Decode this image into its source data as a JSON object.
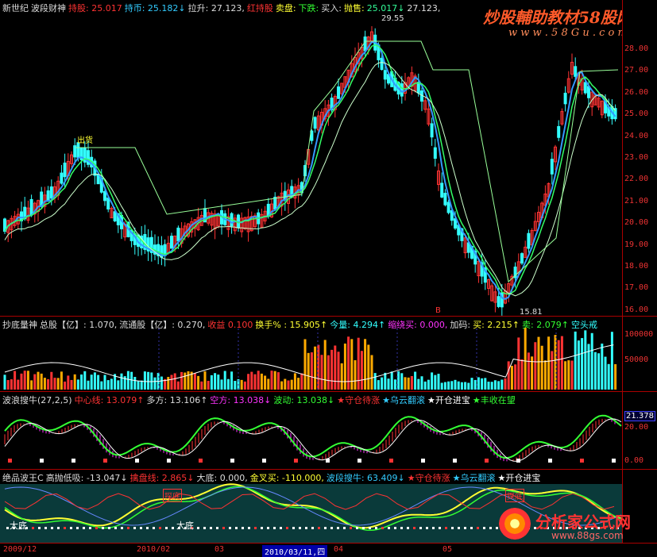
{
  "main_header": [
    {
      "text": "新世纪",
      "color": "#dddddd"
    },
    {
      "text": "波段财神",
      "color": "#dddddd"
    },
    {
      "text": "持股: 25.017",
      "color": "#ff3333"
    },
    {
      "text": "持币: 25.182↓",
      "color": "#33ccff"
    },
    {
      "text": "拉升: 27.123,",
      "color": "#dddddd"
    },
    {
      "text": "红持股",
      "color": "#ff3333"
    },
    {
      "text": "卖盘:",
      "color": "#ffff33"
    },
    {
      "text": "下跌:",
      "color": "#33ff33"
    },
    {
      "text": "买入:",
      "color": "#dddddd"
    },
    {
      "text": "抛售:",
      "color": "#ffff33"
    },
    {
      "text": "25.017↓",
      "color": "#33ff99"
    },
    {
      "text": "27.123,",
      "color": "#dddddd"
    }
  ],
  "watermark_top": {
    "text": "炒股輔助教材58股网",
    "sub": "w w w . 5 8 G u . c o m"
  },
  "watermark_bottom": {
    "text": "分析家公式网",
    "sub": "www.88gs.com"
  },
  "price_axis": [
    "28.00",
    "27.00",
    "26.00",
    "25.00",
    "24.00",
    "23.00",
    "22.00",
    "21.00",
    "20.00",
    "19.00",
    "18.00",
    "17.00",
    "16.00"
  ],
  "price_labels": {
    "high": "29.55",
    "low": "15.81",
    "sell_tag": "出货",
    "buy_tag": "B"
  },
  "vol_header": [
    {
      "text": "抄底量神",
      "color": "#dddddd"
    },
    {
      "text": "总股【亿】: 1.070,",
      "color": "#dddddd"
    },
    {
      "text": "流通股【亿】: 0.270,",
      "color": "#dddddd"
    },
    {
      "text": "收益 0.100",
      "color": "#ff3333"
    },
    {
      "text": "换手% : 15.905↑",
      "color": "#ffff33"
    },
    {
      "text": "今量: 4.294↑",
      "color": "#33ffff"
    },
    {
      "text": "缩绕买: 0.000,",
      "color": "#ff33ff"
    },
    {
      "text": "加码:",
      "color": "#dddddd"
    },
    {
      "text": "买: 2.215↑",
      "color": "#ffff33"
    },
    {
      "text": "卖: 2.079↑",
      "color": "#33ff33"
    },
    {
      "text": "空头戒",
      "color": "#33ffff"
    }
  ],
  "vol_axis": [
    "100000",
    "50000"
  ],
  "osc1_header": [
    {
      "text": "波浪搜牛(27,2,5)",
      "color": "#dddddd"
    },
    {
      "text": "中心线: 13.079↑",
      "color": "#ff3333"
    },
    {
      "text": "多方: 13.106↑",
      "color": "#dddddd"
    },
    {
      "text": "空方: 13.038↓",
      "color": "#ff33ff"
    },
    {
      "text": "波动: 13.038↓",
      "color": "#33ff33"
    },
    {
      "text": "★守仓待涨",
      "color": "#ff3333"
    },
    {
      "text": "★乌云翻滚",
      "color": "#33ccff"
    },
    {
      "text": "★开仓进宝",
      "color": "#ffffff"
    },
    {
      "text": "★丰收在望",
      "color": "#33ff33"
    }
  ],
  "osc1_axis": {
    "current": "21.378",
    "ticks": [
      "20.00",
      "0.00"
    ]
  },
  "osc2_header": [
    {
      "text": "绝品波王C",
      "color": "#dddddd"
    },
    {
      "text": "高抛低吸: -13.047↓",
      "color": "#dddddd"
    },
    {
      "text": "擒盘线: 2.865↓",
      "color": "#ff3333"
    },
    {
      "text": "大底: 0.000,",
      "color": "#dddddd"
    },
    {
      "text": "金叉买: -110.000,",
      "color": "#ffff33"
    },
    {
      "text": "波段搜牛: 63.409↓",
      "color": "#33ccff"
    },
    {
      "text": "★守仓待涨",
      "color": "#ff3333"
    },
    {
      "text": "★乌云翻滚",
      "color": "#33ccff"
    },
    {
      "text": "★开仓进宝",
      "color": "#ffffff"
    }
  ],
  "osc2_labels": {
    "bottom1": "大底",
    "bottom2": "大底",
    "marker1": "探底",
    "marker2": "探底"
  },
  "date_axis": [
    {
      "text": "2009/12",
      "selected": false
    },
    {
      "text": "2010/02",
      "selected": false
    },
    {
      "text": "03",
      "selected": false
    },
    {
      "text": "2010/03/11,四",
      "selected": true
    },
    {
      "text": "04",
      "selected": false
    },
    {
      "text": "05",
      "selected": false
    }
  ],
  "colors": {
    "up": "#ff3333",
    "down": "#33ffff",
    "fastma": "#3399ff",
    "midma": "#33ff66",
    "slowma": "#ccffcc",
    "axis": "#aa0000"
  }
}
